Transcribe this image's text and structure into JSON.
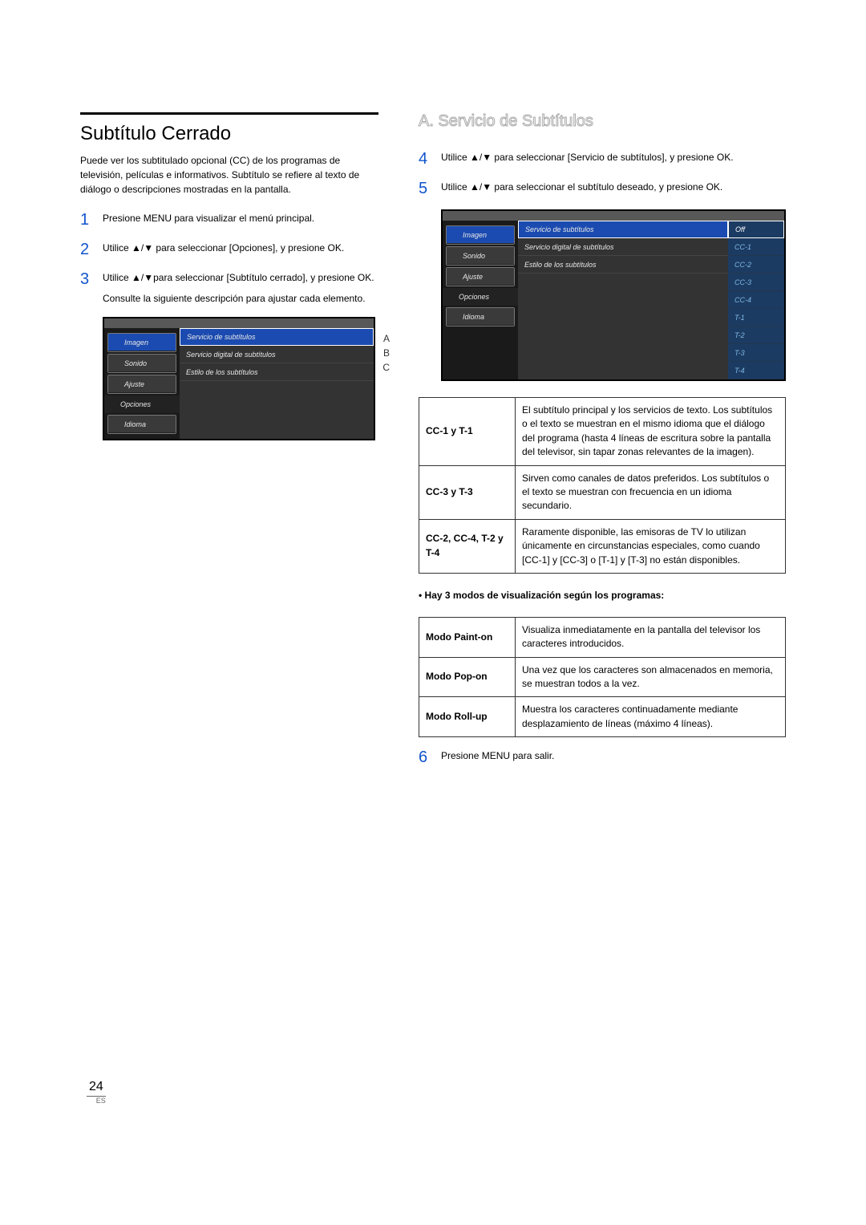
{
  "left": {
    "title": "Subtítulo Cerrado",
    "intro": "Puede ver los subtitulado opcional (CC) de los programas de televisión, películas e informativos. Subtítulo se refiere al texto de diálogo o descripciones mostradas en la pantalla.",
    "step1": "Presione MENU para visualizar el menú principal.",
    "step2": "Utilice ▲/▼ para seleccionar [Opciones], y presione OK.",
    "step3": "Utilice ▲/▼para seleccionar [Subtítulo cerrado], y presione OK.",
    "step3b": "Consulte la siguiente descripción para ajustar cada elemento.",
    "menu_items": [
      "Imagen",
      "Sonido",
      "Ajuste",
      "Opciones",
      "Idioma"
    ],
    "mid_rows": [
      "Servicio de subtítulos",
      "Servicio digital de subtítulos",
      "Estilo de los subtítulos"
    ],
    "callouts": {
      "a": "A",
      "b": "B",
      "c": "C"
    }
  },
  "right": {
    "heading": "A. Servicio de Subtítulos",
    "step4": "Utilice ▲/▼ para seleccionar [Servicio de subtítulos], y presione OK.",
    "step5": "Utilice ▲/▼ para seleccionar el subtítulo deseado, y presione OK.",
    "menu_items": [
      "Imagen",
      "Sonido",
      "Ajuste",
      "Opciones",
      "Idioma"
    ],
    "mid_rows": [
      "Servicio de subtítulos",
      "Servicio digital de subtítulos",
      "Estilo de los subtítulos"
    ],
    "right_rows": [
      "Off",
      "CC-1",
      "CC-2",
      "CC-3",
      "CC-4",
      "T-1",
      "T-2",
      "T-3",
      "T-4"
    ],
    "table1": [
      {
        "k": "CC-1 y T-1",
        "v": "El subtítulo principal y los servicios de texto.\nLos subtítulos o el texto se muestran en el mismo idioma que el diálogo del programa (hasta 4 líneas de escritura sobre la pantalla del televisor, sin tapar zonas relevantes de la imagen)."
      },
      {
        "k": "CC-3 y T-3",
        "v": "Sirven como canales de datos preferidos. Los subtítulos o el texto se muestran con frecuencia en un idioma secundario."
      },
      {
        "k": "CC-2, CC-4, T-2 y T-4",
        "v": "Raramente disponible, las emisoras de TV lo utilizan únicamente en circunstancias especiales, como cuando [CC-1] y [CC-3] o [T-1] y [T-3] no están disponibles."
      }
    ],
    "bullet": "• Hay 3 modos de visualización según los programas:",
    "table2": [
      {
        "k": "Modo Paint-on",
        "v": "Visualiza inmediatamente en la pantalla del televisor los caracteres introducidos."
      },
      {
        "k": "Modo Pop-on",
        "v": "Una vez que los caracteres son almacenados en memoria, se muestran todos a la vez."
      },
      {
        "k": "Modo Roll-up",
        "v": "Muestra los caracteres continuadamente mediante desplazamiento de líneas (máximo 4 líneas)."
      }
    ],
    "step6": "Presione MENU para salir."
  },
  "page": {
    "num": "24",
    "lang": "ES"
  }
}
